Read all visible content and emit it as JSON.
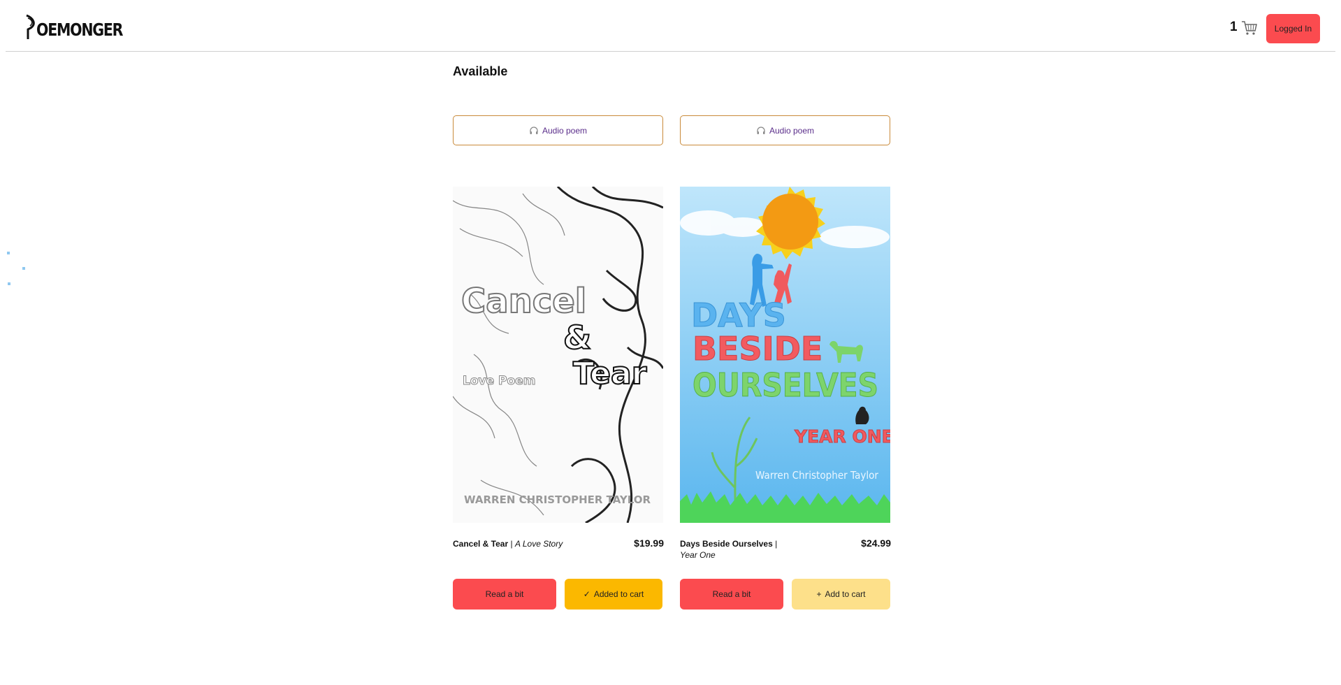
{
  "header": {
    "logo_text": "OEMONGER",
    "cart_count": "1",
    "login_label": "Logged In"
  },
  "section": {
    "title": "Available"
  },
  "products": [
    {
      "audio_label": "Audio poem",
      "cover": {
        "word1": "Cancel",
        "amp": "&",
        "word2": "Tear",
        "subtitle": "Love Poem",
        "author": "WARREN CHRISTOPHER TAYLOR"
      },
      "title": "Cancel & Tear",
      "separator": " | ",
      "subtitle": "A Love Story",
      "price": "$19.99",
      "read_label": "Read a bit",
      "cart_label": "Added to cart",
      "cart_symbol": "✓"
    },
    {
      "audio_label": "Audio poem",
      "cover": {
        "line1": "DAYS",
        "line2": "BESIDE",
        "line3": "OURSELVES",
        "line4": "YEAR ONE",
        "author": "Warren Christopher Taylor"
      },
      "title": "Days Beside Ourselves",
      "separator": " | ",
      "subtitle": "Year One",
      "price": "$24.99",
      "read_label": "Read a bit",
      "cart_label": "Add to cart",
      "cart_symbol": "+"
    }
  ],
  "colors": {
    "red": "#fb4b4f",
    "amber": "#fbb800",
    "pale_amber": "#fde08a",
    "audio_border": "#c98a3a",
    "audio_text": "#5a2d8a"
  }
}
